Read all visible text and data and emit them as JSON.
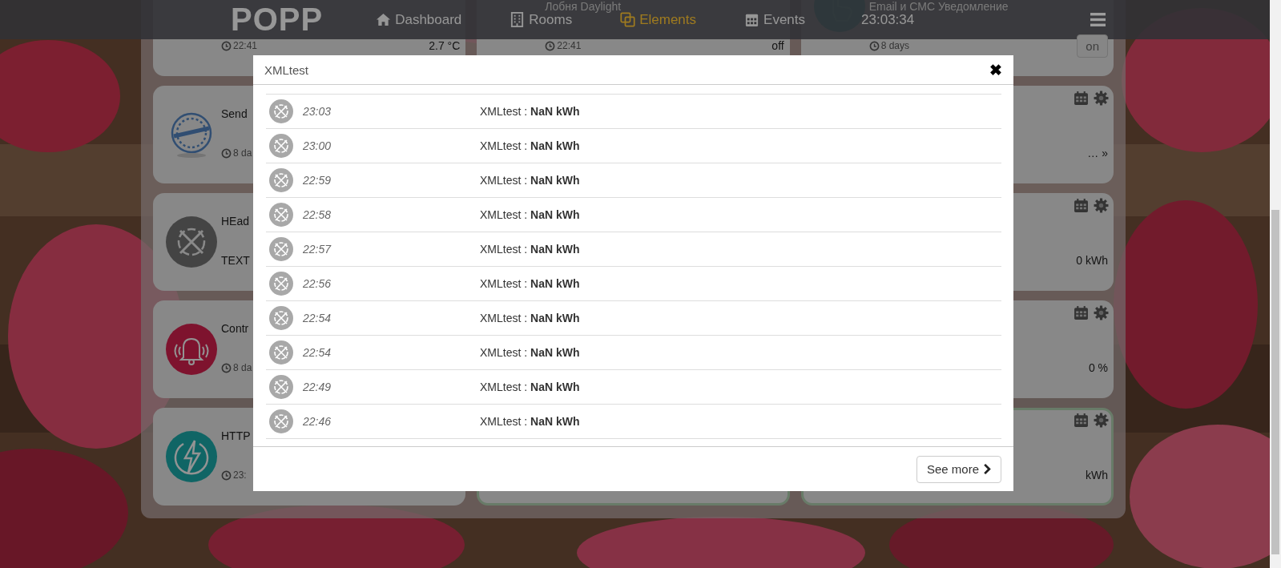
{
  "navbar": {
    "logo": "POPP",
    "items": [
      {
        "label": "Dashboard",
        "selected": false
      },
      {
        "label": "Rooms",
        "selected": false
      },
      {
        "label": "Elements",
        "selected": true
      },
      {
        "label": "Events",
        "selected": false
      }
    ],
    "clock": "23:03:34"
  },
  "columns": [
    [
      {
        "time": "22:41",
        "value": "2.7 °C",
        "highlighted": false
      },
      {
        "title": "Send",
        "time": "8 da",
        "highlighted": false
      },
      {
        "title": "HEad",
        "text": "TEXT",
        "highlighted": false
      },
      {
        "title": "Contr",
        "time": "8 da",
        "highlighted": false
      },
      {
        "title": "HTTP",
        "time": "23:",
        "highlighted": false
      }
    ],
    [
      {
        "title": "Лобня Daylight",
        "time": "22:41",
        "value": "off",
        "highlighted": false
      },
      {
        "highlighted": true
      }
    ],
    [
      {
        "title": "Email и СМС Уведомление",
        "time": "8 days",
        "button": "on",
        "highlighted": false
      },
      {
        "value": "… »",
        "actions": true,
        "highlighted": false
      },
      {
        "value": "0 kWh",
        "actions": true,
        "highlighted": false
      },
      {
        "value": "0 %",
        "actions": true,
        "highlighted": false
      },
      {
        "value": "kWh",
        "actions": true,
        "highlighted": true
      }
    ]
  ],
  "modal": {
    "title": "XMLtest",
    "close": "✖",
    "rows": [
      {
        "time": "23:03",
        "text": "XMLtest : **NaN kWh**"
      },
      {
        "time": "23:00",
        "text": "XMLtest : **NaN kWh**"
      },
      {
        "time": "22:59",
        "text": "XMLtest : **NaN kWh**"
      },
      {
        "time": "22:58",
        "text": "XMLtest : **NaN kWh**"
      },
      {
        "time": "22:57",
        "text": "XMLtest : **NaN kWh**"
      },
      {
        "time": "22:56",
        "text": "XMLtest : **NaN kWh**"
      },
      {
        "time": "22:54",
        "text": "XMLtest : **NaN kWh**"
      },
      {
        "time": "22:54",
        "text": "XMLtest : **NaN kWh**"
      },
      {
        "time": "22:49",
        "text": "XMLtest : **NaN kWh**"
      },
      {
        "time": "22:46",
        "text": "XMLtest : **NaN kWh**"
      }
    ],
    "button": "See more"
  }
}
